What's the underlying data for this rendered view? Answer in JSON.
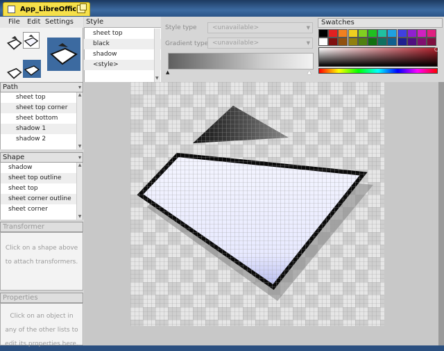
{
  "window": {
    "title": "App_LibreOffice"
  },
  "menu": [
    "File",
    "Edit",
    "Settings"
  ],
  "style_panel": {
    "header": "Style",
    "items": [
      "sheet top",
      "black",
      "shadow",
      "<style>"
    ]
  },
  "style_settings": {
    "style_type_label": "Style type",
    "style_type_value": "<unavailable>",
    "gradient_type_label": "Gradient type",
    "gradient_type_value": "<unavailable>"
  },
  "swatches": {
    "header": "Swatches",
    "colors_row1": [
      "#000000",
      "#e02020",
      "#f08020",
      "#f0d020",
      "#80d020",
      "#20c020",
      "#20c0a0",
      "#20a0e0",
      "#4040e0",
      "#9020d0",
      "#d020c0",
      "#e02080"
    ],
    "colors_row2": [
      "#ffffff",
      "#801010",
      "#905010",
      "#908010",
      "#508010",
      "#107010",
      "#107060",
      "#106090",
      "#202090",
      "#501080",
      "#801070",
      "#801040"
    ]
  },
  "path_panel": {
    "header": "Path",
    "items": [
      "sheet top",
      "sheet top corner",
      "sheet bottom",
      "shadow 1",
      "shadow 2"
    ]
  },
  "shape_panel": {
    "header": "Shape",
    "items": [
      "shadow",
      "sheet top outline",
      "sheet top",
      "sheet corner outline",
      "sheet corner"
    ]
  },
  "transformer_panel": {
    "header": "Transformer",
    "hint_line1": "Click on a shape above",
    "hint_line2": "to attach transformers."
  },
  "properties_panel": {
    "header": "Properties",
    "hint_line1": "Click on an object in",
    "hint_line2": "any of the other lists to",
    "hint_line3": "edit its properties here."
  },
  "colors": {
    "title_tab": "#f6e04a",
    "canvas_fill": "#eef0ff",
    "icon_blue": "#3c6aa0"
  }
}
